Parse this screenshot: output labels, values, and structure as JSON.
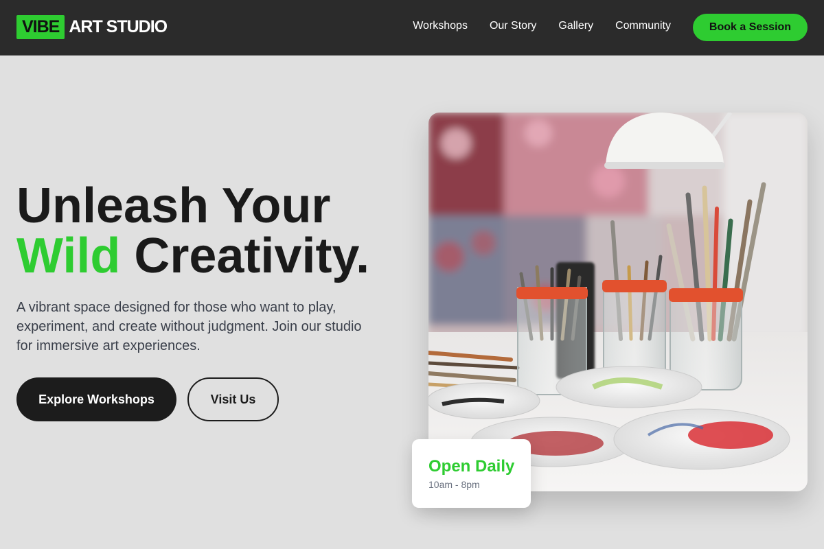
{
  "header": {
    "logo_badge": "VIBE",
    "logo_text": "ART STUDIO",
    "nav": [
      {
        "label": "Workshops"
      },
      {
        "label": "Our Story"
      },
      {
        "label": "Gallery"
      },
      {
        "label": "Community"
      }
    ],
    "cta_label": "Book a Session"
  },
  "hero": {
    "title_line1": "Unleash Your",
    "title_accent": "Wild",
    "title_line2_rest": " Creativity.",
    "description": "A vibrant space designed for those who want to play, experiment, and create without judgment. Join our studio for immersive art experiences.",
    "primary_button": "Explore Workshops",
    "secondary_button": "Visit Us",
    "image_alt": "Jars of paint brushes and paint palettes on a studio table",
    "hours_title": "Open Daily",
    "hours_time": "10am - 8pm"
  },
  "colors": {
    "accent": "#2ecc31",
    "header_bg": "#2b2b2b",
    "page_bg": "#e0e0e0",
    "dark": "#1c1c1c"
  }
}
